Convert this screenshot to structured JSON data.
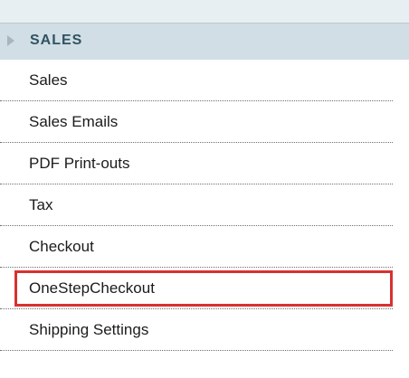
{
  "section": {
    "title": "SALES"
  },
  "items": [
    {
      "label": "Sales"
    },
    {
      "label": "Sales Emails"
    },
    {
      "label": "PDF Print-outs"
    },
    {
      "label": "Tax"
    },
    {
      "label": "Checkout"
    },
    {
      "label": "OneStepCheckout"
    },
    {
      "label": "Shipping Settings"
    }
  ],
  "highlight": {
    "item": "OneStepCheckout",
    "border_color": "#d83131"
  },
  "colors": {
    "header_bg": "#d1dee5",
    "header_text": "#2f5361",
    "strip_bg": "#e7eff2"
  }
}
